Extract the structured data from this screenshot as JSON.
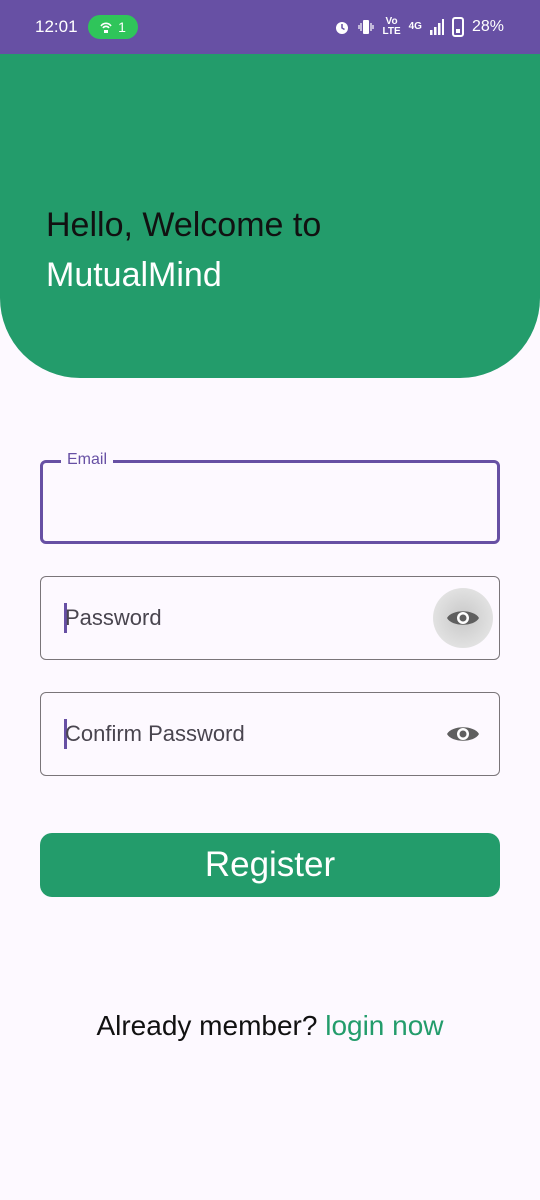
{
  "status_bar": {
    "time": "12:01",
    "hotspot_count": "1",
    "network_vo_top": "Vo",
    "network_vo_bottom": "LTE",
    "network_type": "4G",
    "battery": "28%"
  },
  "header": {
    "welcome_line": "Hello, Welcome to",
    "app_name": "MutualMind",
    "background_color": "#239c6b"
  },
  "form": {
    "email_label": "Email",
    "email_value": "",
    "password_placeholder": "Password",
    "confirm_placeholder": "Confirm Password"
  },
  "actions": {
    "register_label": "Register"
  },
  "footer": {
    "prompt": "Already member?",
    "link": "login now"
  },
  "icons": {
    "password_toggle": "eye-icon",
    "confirm_toggle": "eye-icon"
  },
  "colors": {
    "primary": "#6750a4",
    "accent": "#239c6b"
  }
}
